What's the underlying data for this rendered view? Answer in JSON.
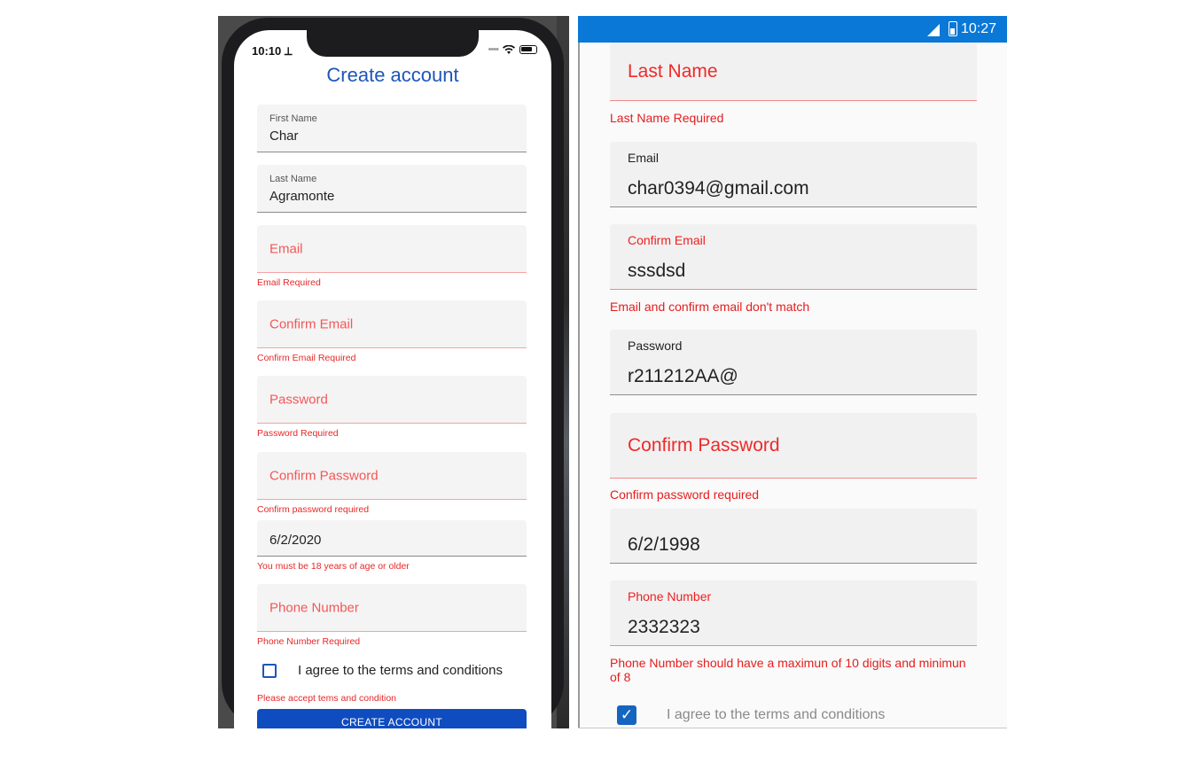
{
  "ios": {
    "status": {
      "time": "10:10 ⟂"
    },
    "title": "Create account",
    "first_name": {
      "label": "First Name",
      "value": "Char"
    },
    "last_name": {
      "label": "Last Name",
      "value": "Agramonte"
    },
    "email": {
      "placeholder": "Email",
      "error": "Email Required"
    },
    "confirm_email": {
      "placeholder": "Confirm Email",
      "error": "Confirm Email Required"
    },
    "password": {
      "placeholder": "Password",
      "error": "Password Required"
    },
    "confirm_password": {
      "placeholder": "Confirm Password",
      "error": "Confirm password required"
    },
    "birthdate": {
      "value": "6/2/2020",
      "error": "You must be 18 years of age or older"
    },
    "phone": {
      "placeholder": "Phone Number",
      "error": "Phone Number Required"
    },
    "terms": {
      "label": "I agree to the terms and conditions",
      "checked": false,
      "error": "Please accept tems and condition"
    },
    "create_button": "CREATE ACCOUNT"
  },
  "android": {
    "status": {
      "time": "10:27"
    },
    "last_name": {
      "placeholder": "Last Name",
      "error": "Last Name Required"
    },
    "email": {
      "label": "Email",
      "value": "char0394@gmail.com"
    },
    "confirm_email": {
      "label": "Confirm Email",
      "value": "sssdsd",
      "error": "Email and confirm email don't match"
    },
    "password": {
      "label": "Password",
      "value": "r211212AA@"
    },
    "confirm_password": {
      "placeholder": "Confirm Password",
      "error": "Confirm password required"
    },
    "birthdate": {
      "value": "6/2/1998"
    },
    "phone": {
      "label": "Phone Number",
      "value": "2332323",
      "error": "Phone Number should have a maximun of 10 digits and minimun of 8"
    },
    "terms": {
      "label": "I agree to the terms and conditions",
      "checked": true,
      "check_glyph": "✓"
    }
  },
  "colors": {
    "ios_accent": "#1e56b8",
    "ios_button": "#0f4cc0",
    "error_red": "#e82727",
    "android_statusbar": "#0a78d6",
    "android_checkbox": "#1565c0"
  }
}
